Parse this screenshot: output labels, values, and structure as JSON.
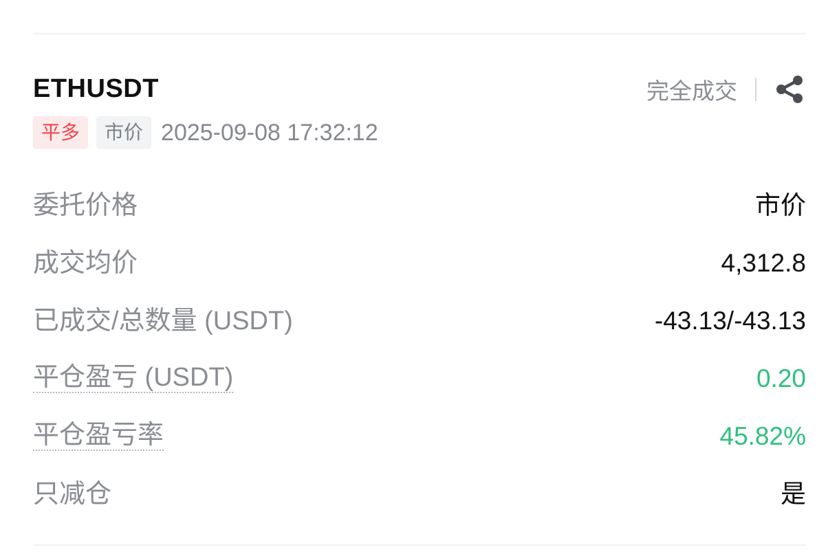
{
  "order": {
    "symbol": "ETHUSDT",
    "status": "完全成交",
    "side_tag": "平多",
    "type_tag": "市价",
    "time": "2025-09-08 17:32:12"
  },
  "icons": {
    "share": "share-icon"
  },
  "colors": {
    "profit": "#2ec07f",
    "side_tag_text": "#f0454c",
    "side_tag_bg": "#fdebeb",
    "muted": "#8a8d93"
  },
  "details": {
    "order_price": {
      "label": "委托价格",
      "value": "市价"
    },
    "avg_price": {
      "label": "成交均价",
      "value": "4,312.8"
    },
    "filled_total": {
      "label": "已成交/总数量 (USDT)",
      "value": "-43.13/-43.13"
    },
    "close_pnl": {
      "label": "平仓盈亏 (USDT)",
      "value": "0.20"
    },
    "close_pnl_rate": {
      "label": "平仓盈亏率",
      "value": "45.82%"
    },
    "reduce_only": {
      "label": "只减仓",
      "value": "是"
    }
  }
}
